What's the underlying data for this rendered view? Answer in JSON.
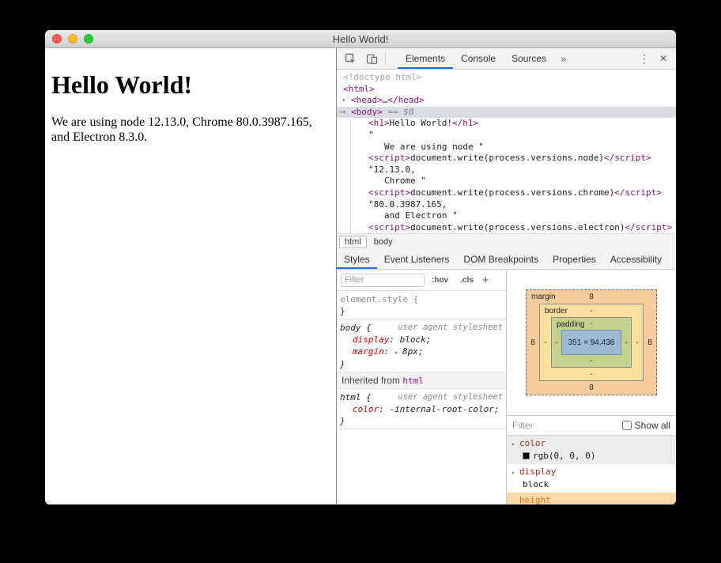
{
  "window": {
    "title": "Hello World!"
  },
  "page": {
    "heading": "Hello World!",
    "paragraph": "We are using node 12.13.0, Chrome 80.0.3987.165, and Electron 8.3.0."
  },
  "devtools": {
    "toolbar": {
      "tabs": [
        {
          "label": "Elements",
          "selected": true
        },
        {
          "label": "Console",
          "selected": false
        },
        {
          "label": "Sources",
          "selected": false
        },
        {
          "label": "»",
          "selected": false,
          "overflow": true
        }
      ]
    },
    "tree": {
      "lines": [
        {
          "indent": 0,
          "tokens": [
            {
              "t": "<!doctype html>",
              "c": "muted"
            }
          ]
        },
        {
          "indent": 0,
          "tokens": [
            {
              "t": "<html>",
              "c": "tag"
            }
          ]
        },
        {
          "indent": 1,
          "arrow": "▸",
          "tokens": [
            {
              "t": "<head>",
              "c": "tag"
            },
            {
              "t": "…",
              "c": "text"
            },
            {
              "t": "</head>",
              "c": "tag"
            }
          ]
        },
        {
          "indent": 1,
          "arrow": "▾",
          "dots": true,
          "selected": true,
          "tokens": [
            {
              "t": "<body>",
              "c": "tag"
            },
            {
              "t": " == $0",
              "c": "meta"
            }
          ]
        },
        {
          "indent": 2,
          "tokens": [
            {
              "t": "<h1>",
              "c": "tag"
            },
            {
              "t": "Hello World!",
              "c": "text"
            },
            {
              "t": "</h1>",
              "c": "tag"
            }
          ]
        },
        {
          "indent": 2,
          "tokens": [
            {
              "t": "\"",
              "c": "text"
            }
          ]
        },
        {
          "indent": 3,
          "tokens": [
            {
              "t": "We are using node \"",
              "c": "text"
            }
          ]
        },
        {
          "indent": 2,
          "tokens": [
            {
              "t": "<script>",
              "c": "tag"
            },
            {
              "t": "document.write(process.versions.node)",
              "c": "text"
            },
            {
              "t": "</script>",
              "c": "tag"
            }
          ]
        },
        {
          "indent": 2,
          "tokens": [
            {
              "t": "\"12.13.0,",
              "c": "text"
            }
          ]
        },
        {
          "indent": 3,
          "tokens": [
            {
              "t": "Chrome \"",
              "c": "text"
            }
          ]
        },
        {
          "indent": 2,
          "tokens": [
            {
              "t": "<script>",
              "c": "tag"
            },
            {
              "t": "document.write(process.versions.chrome)",
              "c": "text"
            },
            {
              "t": "</script>",
              "c": "tag"
            }
          ]
        },
        {
          "indent": 2,
          "tokens": [
            {
              "t": "\"80.0.3987.165,",
              "c": "text"
            }
          ]
        },
        {
          "indent": 3,
          "tokens": [
            {
              "t": "and Electron \"",
              "c": "text"
            }
          ]
        },
        {
          "indent": 2,
          "tokens": [
            {
              "t": "<script>",
              "c": "tag"
            },
            {
              "t": "document.write(process.versions.electron)",
              "c": "text"
            },
            {
              "t": "</script>",
              "c": "tag"
            }
          ]
        }
      ]
    },
    "breadcrumbs": [
      {
        "label": "html",
        "boxed": true
      },
      {
        "label": "body",
        "boxed": false
      }
    ],
    "panel_tabs": [
      {
        "label": "Styles",
        "selected": true
      },
      {
        "label": "Event Listeners",
        "selected": false
      },
      {
        "label": "DOM Breakpoints",
        "selected": false
      },
      {
        "label": "Properties",
        "selected": false
      },
      {
        "label": "Accessibility",
        "selected": false
      }
    ],
    "styles_pane": {
      "filter_placeholder": "Filter",
      "pseudo_toggle": ":hov",
      "class_toggle": ".cls",
      "new_rule": "+",
      "sections": [
        {
          "selector": "element.style",
          "muted": true,
          "origin": "",
          "props": []
        },
        {
          "selector": "body",
          "origin": "user agent stylesheet",
          "props": [
            {
              "name": "display",
              "value": "block"
            },
            {
              "name": "margin",
              "value": "8px",
              "expandable": true
            }
          ]
        },
        {
          "header": "Inherited from ",
          "header_link": "html"
        },
        {
          "selector": "html",
          "origin": "user agent stylesheet",
          "props": [
            {
              "name": "color",
              "value": "-internal-root-color"
            }
          ]
        }
      ]
    },
    "box_model": {
      "margin": {
        "label": "margin",
        "top": "8",
        "right": "8",
        "bottom": "8",
        "left": "8"
      },
      "border": {
        "label": "border",
        "top": "-",
        "right": "-",
        "bottom": "-",
        "left": "-"
      },
      "padding": {
        "label": "padding",
        "top": "-",
        "right": "-",
        "bottom": "-",
        "left": "-"
      },
      "content": "351 × 94.438"
    },
    "computed_pane": {
      "filter_placeholder": "Filter",
      "show_all": "Show all",
      "properties": [
        {
          "name": "color",
          "value": "rgb(0, 0, 0)",
          "swatch": "#000000",
          "shaded": true
        },
        {
          "name": "display",
          "value": "block",
          "shaded": false
        },
        {
          "name": "height",
          "value": "",
          "highlight": true
        }
      ]
    }
  },
  "colors": {
    "accent_blue": "#1a73e8",
    "tag_purple": "#881280",
    "property_red": "#c80000",
    "selection_gray": "#d9dde2",
    "box_margin": "#f9cc9d",
    "box_border": "#fbdf9d",
    "box_padding": "#c4d08d",
    "box_content": "#9cbad3",
    "traffic_red": "#ff5f57",
    "traffic_yellow": "#febc2e",
    "traffic_green": "#28c840"
  }
}
